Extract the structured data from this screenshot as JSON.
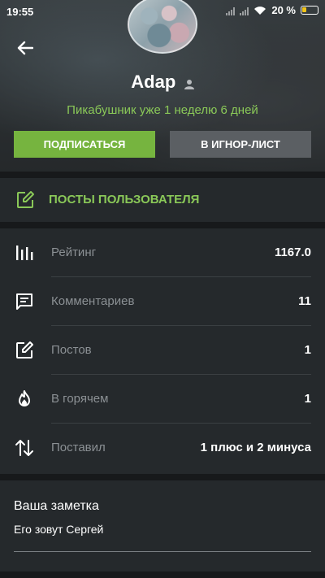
{
  "status_bar": {
    "time": "19:55",
    "battery": "20 %"
  },
  "profile": {
    "username": "Adap",
    "member_since": "Пикабушник уже 1 неделю 6 дней",
    "subscribe_label": "ПОДПИСАТЬСЯ",
    "ignore_label": "В ИГНОР-ЛИСТ"
  },
  "posts_link": {
    "label": "ПОСТЫ ПОЛЬЗОВАТЕЛЯ"
  },
  "stats": [
    {
      "icon": "bar-chart-icon",
      "name": "Рейтинг",
      "value": "1167.0"
    },
    {
      "icon": "comment-icon",
      "name": "Комментариев",
      "value": "11"
    },
    {
      "icon": "edit-icon",
      "name": "Постов",
      "value": "1"
    },
    {
      "icon": "flame-icon",
      "name": "В горячем",
      "value": "1"
    },
    {
      "icon": "swap-arrows-icon",
      "name": "Поставил",
      "value": "1 плюс и 2 минуса"
    }
  ],
  "note": {
    "title": "Ваша заметка",
    "text": "Его зовут Сергей"
  },
  "colors": {
    "accent": "#76b43f",
    "accent_text": "#8ac858",
    "panel": "#25292c",
    "background": "#17191b"
  }
}
